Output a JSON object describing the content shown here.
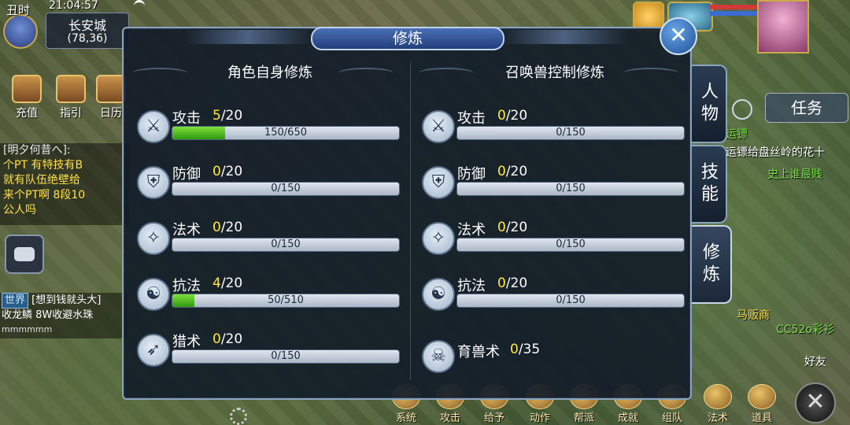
{
  "hud": {
    "shichen": "丑时",
    "time": "21:04:57",
    "map": "长安城",
    "coords": "(78,36)"
  },
  "quick_buttons": [
    {
      "label": "充值",
      "icon": "treasure-chest-icon"
    },
    {
      "label": "指引",
      "icon": "guide-icon"
    },
    {
      "label": "日历",
      "icon": "calendar-icon"
    }
  ],
  "chat": {
    "team_sender": "[明夕何昔へ]:",
    "team_lines": [
      "个PT 有特技有B",
      "就有队伍绝壁给",
      "来个PT啊 8段10",
      "公人吗"
    ],
    "world_tag": "世界",
    "world_line1": "[想到钱就头大]",
    "world_line2": "收龙鳞  8W收避水珠",
    "world_line3": "mmmmmm"
  },
  "right_hud": {
    "task_label": "任务",
    "quest_lines": [
      "运镖",
      "运镖给盘丝岭的花十",
      "史上谁最贱"
    ],
    "npc_names": [
      "马贩商",
      "CC52o彩衫"
    ],
    "friend_label": "好友"
  },
  "side_tabs": [
    {
      "label": "人物",
      "active": false
    },
    {
      "label": "技能",
      "active": false
    },
    {
      "label": "修炼",
      "active": true
    }
  ],
  "bottom_bar": [
    "系统",
    "攻击",
    "给予",
    "动作",
    "帮派",
    "成就",
    "组队",
    "法术",
    "道具"
  ],
  "dialog": {
    "title": "修炼",
    "close_label": "✕",
    "left": {
      "title": "角色自身修炼",
      "rows": [
        {
          "name": "攻击",
          "cur": "5",
          "max": "/20",
          "bar": "150/650",
          "progress": 0.231,
          "icon": "sword-icon",
          "glyph": "⚔"
        },
        {
          "name": "防御",
          "cur": "0",
          "max": "/20",
          "bar": "0/150",
          "progress": 0,
          "icon": "shield-icon",
          "glyph": "⛨"
        },
        {
          "name": "法术",
          "cur": "0",
          "max": "/20",
          "bar": "0/150",
          "progress": 0,
          "icon": "staff-icon",
          "glyph": "✧"
        },
        {
          "name": "抗法",
          "cur": "4",
          "max": "/20",
          "bar": "50/510",
          "progress": 0.098,
          "icon": "yinyang-icon",
          "glyph": "☯"
        },
        {
          "name": "猎术",
          "cur": "0",
          "max": "/20",
          "bar": "0/150",
          "progress": 0,
          "icon": "bow-icon",
          "glyph": "➶"
        }
      ]
    },
    "right": {
      "title": "召唤兽控制修炼",
      "rows": [
        {
          "name": "攻击",
          "cur": "0",
          "max": "/20",
          "bar": "0/150",
          "progress": 0,
          "icon": "sword-icon",
          "glyph": "⚔"
        },
        {
          "name": "防御",
          "cur": "0",
          "max": "/20",
          "bar": "0/150",
          "progress": 0,
          "icon": "shield-icon",
          "glyph": "⛨"
        },
        {
          "name": "法术",
          "cur": "0",
          "max": "/20",
          "bar": "0/150",
          "progress": 0,
          "icon": "staff-icon",
          "glyph": "✧"
        },
        {
          "name": "抗法",
          "cur": "0",
          "max": "/20",
          "bar": "0/150",
          "progress": 0,
          "icon": "yinyang-icon",
          "glyph": "☯"
        }
      ],
      "extra": {
        "name": "育兽术",
        "cur": "0",
        "max": "/35",
        "icon": "beast-skull-icon",
        "glyph": "☠"
      }
    }
  }
}
